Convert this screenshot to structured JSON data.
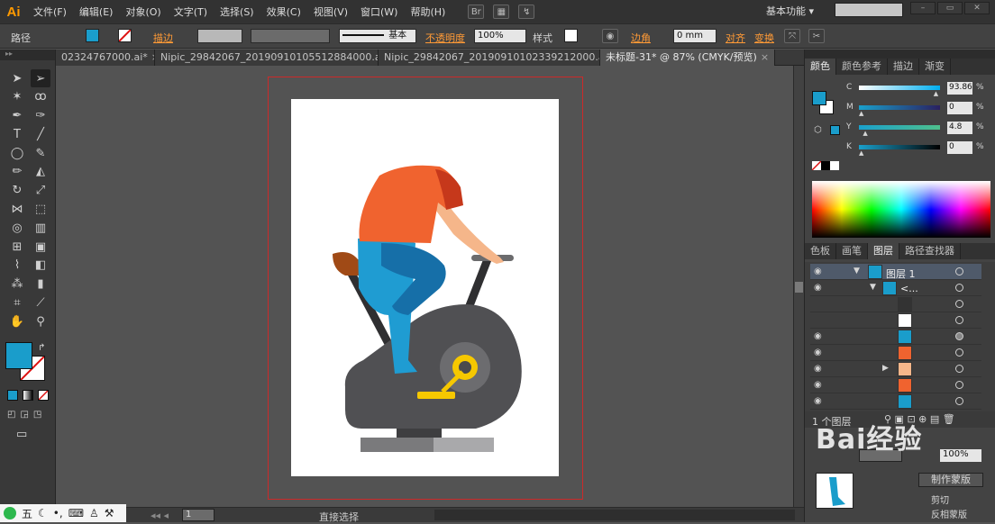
{
  "app": {
    "logo": "Ai"
  },
  "menu": [
    "文件(F)",
    "编辑(E)",
    "对象(O)",
    "文字(T)",
    "选择(S)",
    "效果(C)",
    "视图(V)",
    "窗口(W)",
    "帮助(H)"
  ],
  "workspace": {
    "label": "基本功能"
  },
  "control_bar": {
    "selection_label": "路径",
    "stroke_label": "描边",
    "stroke_style": "基本",
    "opacity_label": "不透明度",
    "opacity_value": "100%",
    "style_label": "样式",
    "corner_label": "边角",
    "corner_value": "0 mm",
    "align_label": "对齐",
    "transform_label": "变换",
    "fill_color": "#1a9dcb"
  },
  "doc_tabs": [
    {
      "label": "02324767000.ai*",
      "close": "×"
    },
    {
      "label": "Nipic_29842067_20190910105512884000.ai*",
      "close": "×"
    },
    {
      "label": "Nipic_29842067_20190910102339212000.ai*",
      "close": "×"
    },
    {
      "label": "未标题-31* @ 87% (CMYK/预览)",
      "close": "×"
    }
  ],
  "color_panel": {
    "tabs": [
      "颜色",
      "颜色参考",
      "描边",
      "渐变"
    ],
    "channels": [
      {
        "name": "C",
        "value": "93.86",
        "unit": "%",
        "fraction": 0.94
      },
      {
        "name": "M",
        "value": "0",
        "unit": "%",
        "fraction": 0
      },
      {
        "name": "Y",
        "value": "4.8",
        "unit": "%",
        "fraction": 0.05
      },
      {
        "name": "K",
        "value": "0",
        "unit": "%",
        "fraction": 0
      }
    ]
  },
  "layers_panel": {
    "tabs": [
      "色板",
      "画笔",
      "图层",
      "路径查找器"
    ],
    "layer_name": "图层 1",
    "sublayer_name": "<...",
    "footer_count": "1 个图层"
  },
  "bottom_panel": {
    "btn1": "制作蒙版",
    "opt1": "剪切",
    "opt2": "反相蒙版",
    "opacity_value": "100%"
  },
  "status_bar": {
    "zoom": "1",
    "tool_label": "直接选择"
  },
  "ime": {
    "label": "五"
  },
  "colors": {
    "accent": "#ff9a00",
    "body_teal": "#1a9dcb",
    "shirt": "#f0632f",
    "bike": "#4f4f52",
    "bleed": "#cc2a2a"
  }
}
